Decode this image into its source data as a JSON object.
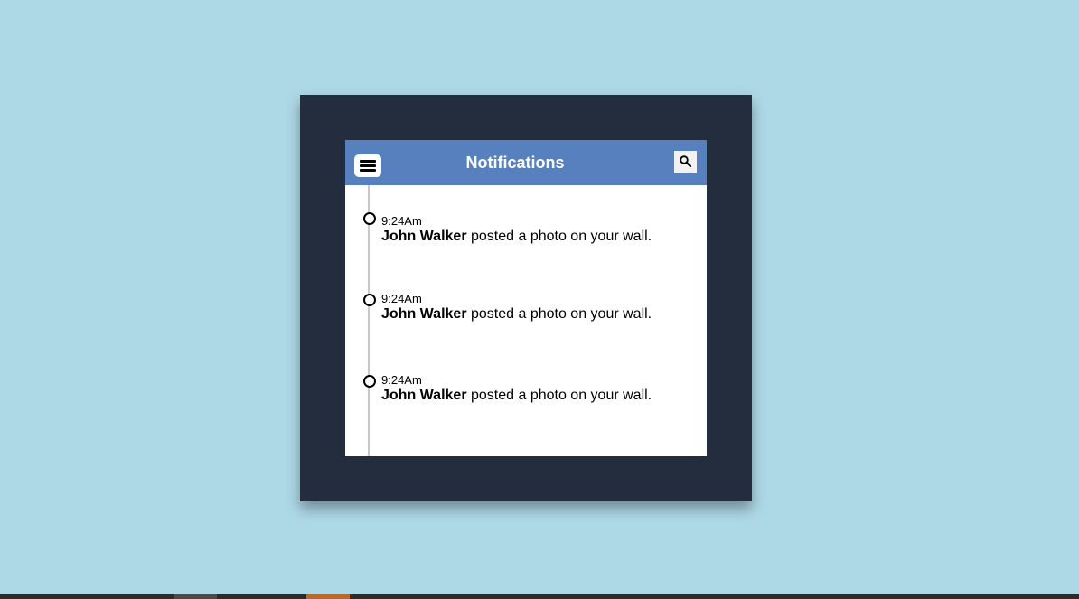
{
  "header": {
    "title": "Notifications",
    "menu_icon": "hamburger-menu-icon",
    "search_icon": "search-icon"
  },
  "notifications": [
    {
      "time": "9:24Am",
      "name": "John Walker",
      "text": " posted a photo on your wall."
    },
    {
      "time": "9:24Am",
      "name": "John Walker",
      "text": " posted a photo on your wall."
    },
    {
      "time": "9:24Am",
      "name": "John Walker",
      "text": " posted a photo on your wall."
    }
  ],
  "colors": {
    "background": "#add8e6",
    "frame": "#232d3d",
    "header": "#5680be",
    "panel": "#ffffff"
  }
}
